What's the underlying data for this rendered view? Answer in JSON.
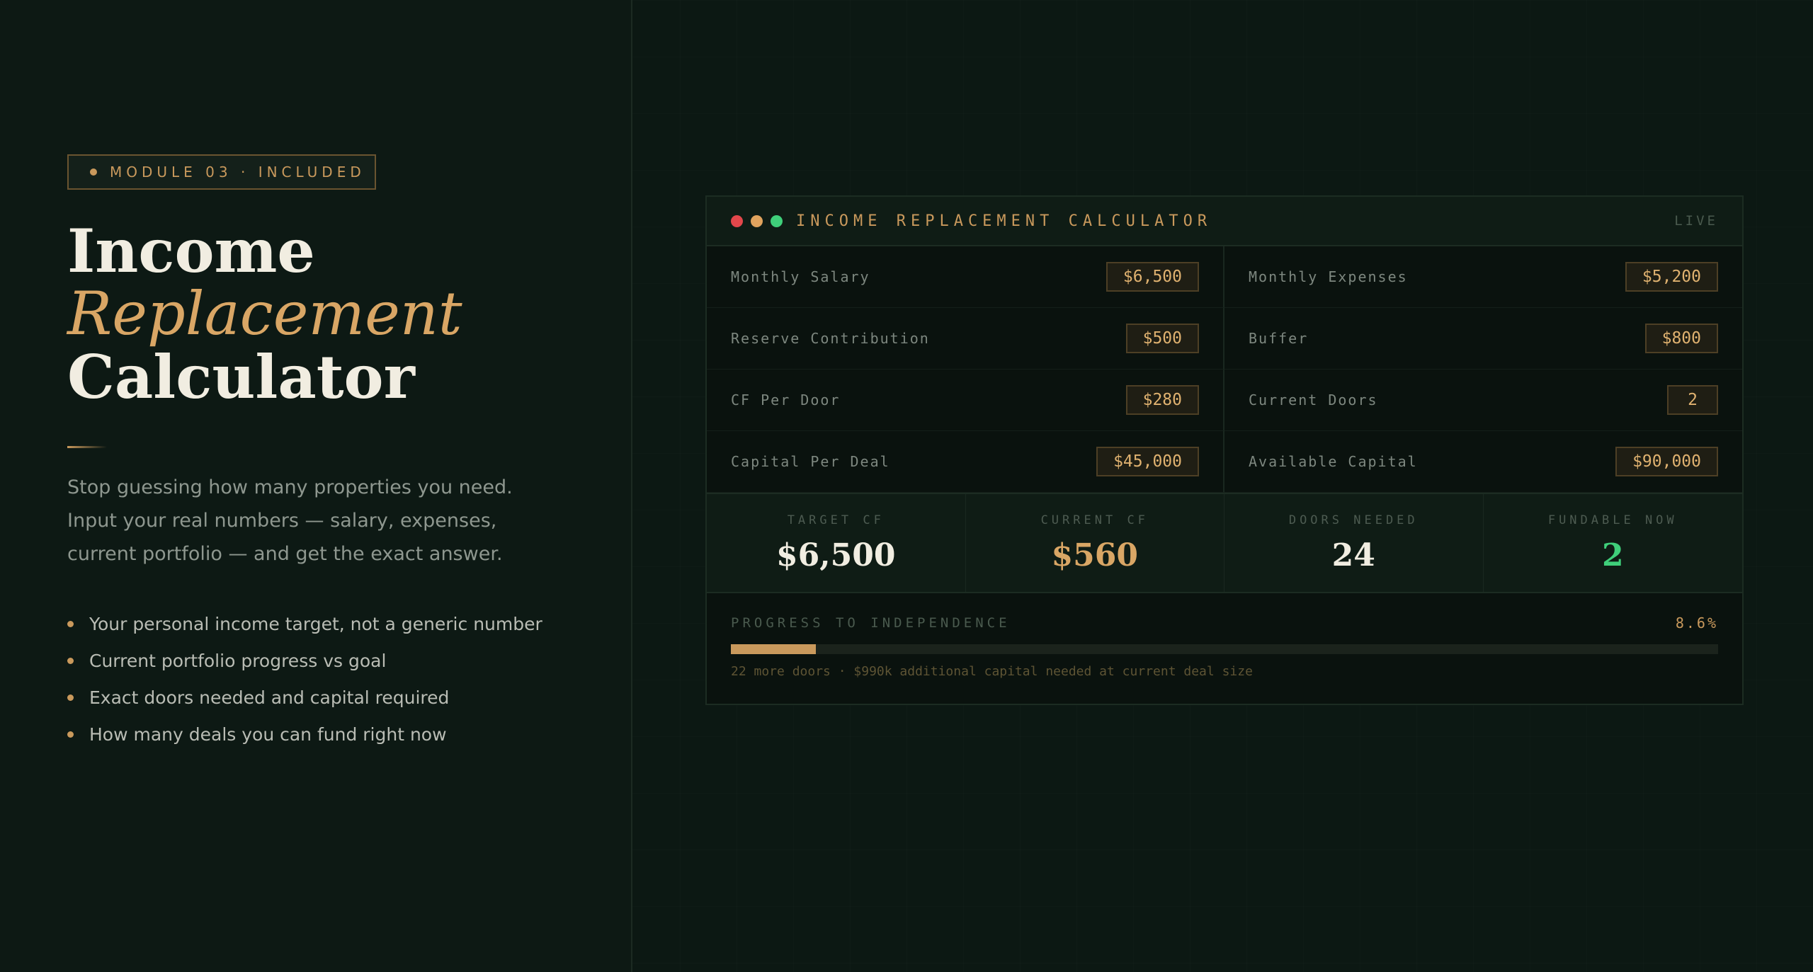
{
  "badge": {
    "label": "MODULE 03 · INCLUDED"
  },
  "hero": {
    "title_line1": "Income",
    "title_line2": "Replacement",
    "title_line3": "Calculator",
    "description": "Stop guessing how many properties you need. Input your real numbers — salary, expenses, current portfolio — and get the exact answer."
  },
  "features": [
    "Your personal income target, not a generic number",
    "Current portfolio progress vs goal",
    "Exact doors needed and capital required",
    "How many deals you can fund right now"
  ],
  "calculator": {
    "title": "INCOME REPLACEMENT CALCULATOR",
    "status": "LIVE",
    "inputs": [
      {
        "label": "Monthly Salary",
        "value": "$6,500"
      },
      {
        "label": "Monthly Expenses",
        "value": "$5,200"
      },
      {
        "label": "Reserve Contribution",
        "value": "$500"
      },
      {
        "label": "Buffer",
        "value": "$800"
      },
      {
        "label": "CF Per Door",
        "value": "$280"
      },
      {
        "label": "Current Doors",
        "value": "2"
      },
      {
        "label": "Capital Per Deal",
        "value": "$45,000"
      },
      {
        "label": "Available Capital",
        "value": "$90,000"
      }
    ],
    "stats": [
      {
        "label": "TARGET CF",
        "value": "$6,500"
      },
      {
        "label": "CURRENT CF",
        "value": "$560"
      },
      {
        "label": "DOORS NEEDED",
        "value": "24"
      },
      {
        "label": "FUNDABLE NOW",
        "value": "2"
      }
    ],
    "progress": {
      "label": "PROGRESS TO INDEPENDENCE",
      "percent_text": "8.6%",
      "percent": 8.6,
      "note": "22 more doors · $990k additional capital needed at current deal size"
    }
  },
  "colors": {
    "background": "#0c1813",
    "accent_gold": "#c9995c",
    "accent_green": "#3fcf7a",
    "dot_red": "#e2474b",
    "dot_yellow": "#e0a35e",
    "dot_green": "#3fcf7a"
  }
}
